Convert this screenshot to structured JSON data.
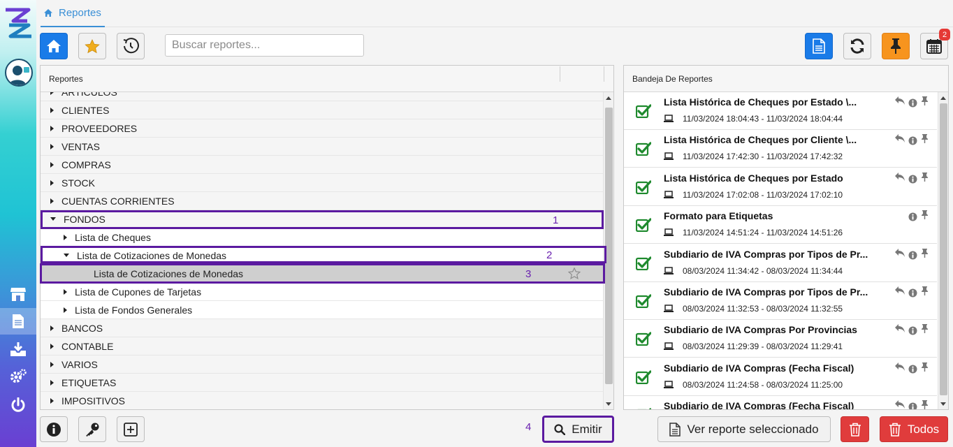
{
  "breadcrumb": {
    "label": "Reportes"
  },
  "toolbar": {
    "search_placeholder": "Buscar reportes...",
    "calendar_badge": "2"
  },
  "tree": {
    "header": "Reportes",
    "rows": [
      {
        "label": "ARTICULOS",
        "caret": "right",
        "indent": 0,
        "style": "cat"
      },
      {
        "label": "CLIENTES",
        "caret": "right",
        "indent": 0,
        "style": "cat"
      },
      {
        "label": "PROVEEDORES",
        "caret": "right",
        "indent": 0,
        "style": "cat"
      },
      {
        "label": "VENTAS",
        "caret": "right",
        "indent": 0,
        "style": "cat"
      },
      {
        "label": "COMPRAS",
        "caret": "right",
        "indent": 0,
        "style": "cat"
      },
      {
        "label": "STOCK",
        "caret": "right",
        "indent": 0,
        "style": "cat"
      },
      {
        "label": "CUENTAS CORRIENTES",
        "caret": "right",
        "indent": 0,
        "style": "cat"
      },
      {
        "label": "FONDOS",
        "caret": "down",
        "indent": 0,
        "style": "cat"
      },
      {
        "label": "Lista de Cheques",
        "caret": "right",
        "indent": 1,
        "style": "child"
      },
      {
        "label": "Lista de Cotizaciones de Monedas",
        "caret": "down",
        "indent": 1,
        "style": "child"
      },
      {
        "label": "Lista de Cotizaciones de Monedas",
        "caret": "none",
        "indent": 2,
        "style": "selected"
      },
      {
        "label": "Lista de Cupones de Tarjetas",
        "caret": "right",
        "indent": 1,
        "style": "child"
      },
      {
        "label": "Lista de Fondos Generales",
        "caret": "right",
        "indent": 1,
        "style": "child"
      },
      {
        "label": "BANCOS",
        "caret": "right",
        "indent": 0,
        "style": "cat"
      },
      {
        "label": "CONTABLE",
        "caret": "right",
        "indent": 0,
        "style": "cat"
      },
      {
        "label": "VARIOS",
        "caret": "right",
        "indent": 0,
        "style": "cat"
      },
      {
        "label": "ETIQUETAS",
        "caret": "right",
        "indent": 0,
        "style": "cat"
      },
      {
        "label": "IMPOSITIVOS",
        "caret": "right",
        "indent": 0,
        "style": "cat"
      }
    ]
  },
  "annotations": {
    "n1": "1",
    "n2": "2",
    "n3": "3",
    "n4": "4"
  },
  "tray": {
    "header": "Bandeja De Reportes",
    "items": [
      {
        "title": "Lista Histórica de Cheques por Estado \\...",
        "dates": "11/03/2024 18:04:43 - 11/03/2024 18:04:44",
        "reply": true
      },
      {
        "title": "Lista Histórica de Cheques por Cliente \\...",
        "dates": "11/03/2024 17:42:30 - 11/03/2024 17:42:32",
        "reply": true
      },
      {
        "title": "Lista Histórica de Cheques por Estado",
        "dates": "11/03/2024 17:02:08 - 11/03/2024 17:02:10",
        "reply": true
      },
      {
        "title": "Formato para Etiquetas",
        "dates": "11/03/2024 14:51:24 - 11/03/2024 14:51:26",
        "reply": false
      },
      {
        "title": "Subdiario de IVA Compras por Tipos de Pr...",
        "dates": "08/03/2024 11:34:42 - 08/03/2024 11:34:44",
        "reply": true
      },
      {
        "title": "Subdiario de IVA Compras por Tipos de Pr...",
        "dates": "08/03/2024 11:32:53 - 08/03/2024 11:32:55",
        "reply": true
      },
      {
        "title": "Subdiario de IVA Compras Por Provincias",
        "dates": "08/03/2024 11:29:39 - 08/03/2024 11:29:41",
        "reply": true
      },
      {
        "title": "Subdiario de IVA Compras (Fecha Fiscal)",
        "dates": "08/03/2024 11:24:58 - 08/03/2024 11:25:00",
        "reply": true
      },
      {
        "title": "Subdiario de IVA Compras (Fecha Fiscal)",
        "dates": "",
        "reply": true
      }
    ]
  },
  "bottom": {
    "emit_label": "Emitir",
    "view_label": "Ver reporte seleccionado",
    "all_label": "Todos"
  }
}
